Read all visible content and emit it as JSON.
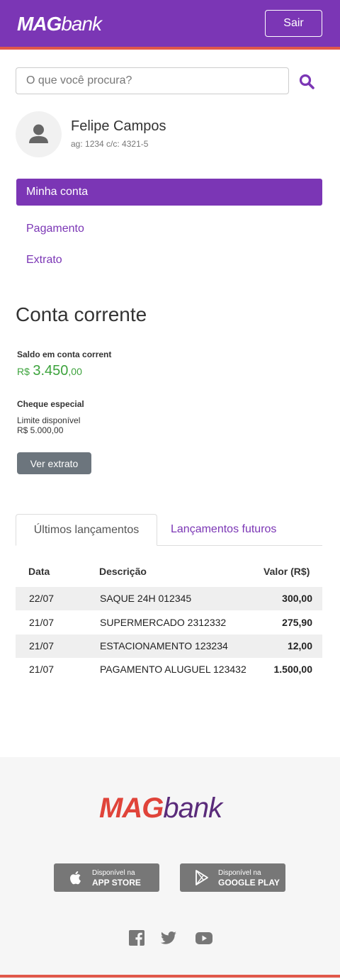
{
  "header": {
    "logo_bold": "MAG",
    "logo_light": "bank",
    "logout_label": "Sair"
  },
  "search": {
    "placeholder": "O que você procura?",
    "icon": "search-icon"
  },
  "user": {
    "name": "Felipe Campos",
    "account": "ag: 1234 c/c: 4321-5",
    "avatar_icon": "user-icon"
  },
  "nav": {
    "items": [
      {
        "label": "Minha conta",
        "active": true
      },
      {
        "label": "Pagamento",
        "active": false
      },
      {
        "label": "Extrato",
        "active": false
      }
    ]
  },
  "account": {
    "title": "Conta corrente",
    "balance_label": "Saldo em conta corrent",
    "balance_currency": "R$",
    "balance_integer": "3.450",
    "balance_decimal": ",00",
    "overdraft_label": "Cheque especial",
    "limit_label": "Limite disponível",
    "limit_value": "R$ 5.000,00",
    "statement_button": "Ver extrato"
  },
  "tabs": [
    {
      "label": "Últimos lançamentos",
      "active": true
    },
    {
      "label": "Lançamentos futuros",
      "active": false
    }
  ],
  "transactions": {
    "headers": {
      "date": "Data",
      "description": "Descrição",
      "value": "Valor (R$)"
    },
    "rows": [
      {
        "date": "22/07",
        "description": "SAQUE 24H 012345",
        "value": "300,00"
      },
      {
        "date": "21/07",
        "description": "SUPERMERCADO 2312332",
        "value": "275,90"
      },
      {
        "date": "21/07",
        "description": "ESTACIONAMENTO 123234",
        "value": "12,00"
      },
      {
        "date": "21/07",
        "description": "PAGAMENTO ALUGUEL 123432",
        "value": "1.500,00"
      }
    ]
  },
  "footer": {
    "logo_bold": "MAG",
    "logo_light": "bank",
    "app_store": {
      "line1": "Disponível na",
      "line2": "APP STORE",
      "icon": "apple-icon"
    },
    "google_play": {
      "line1": "Disponível na",
      "line2": "GOOGLE PLAY",
      "icon": "play-icon"
    },
    "social": [
      "facebook-icon",
      "twitter-icon",
      "youtube-icon"
    ]
  },
  "colors": {
    "brand_purple": "#7b36b5",
    "accent_red": "#e0584a",
    "balance_green": "#3da33d",
    "button_gray": "#6c757d"
  }
}
